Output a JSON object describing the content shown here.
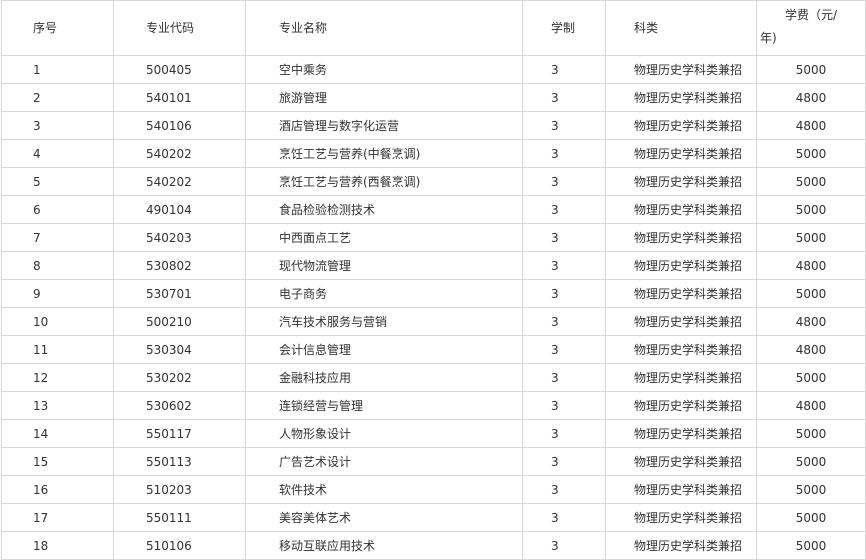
{
  "table": {
    "headers": {
      "no": "序号",
      "code": "专业代码",
      "name": "专业名称",
      "years": "学制",
      "category": "科类",
      "fee_line1": "学费（元/",
      "fee_line2": "年)"
    },
    "rows": [
      {
        "no": "1",
        "code": "500405",
        "name": "空中乘务",
        "years": "3",
        "category": "物理历史学科类兼招",
        "fee": "5000"
      },
      {
        "no": "2",
        "code": "540101",
        "name": "旅游管理",
        "years": "3",
        "category": "物理历史学科类兼招",
        "fee": "4800"
      },
      {
        "no": "3",
        "code": "540106",
        "name": "酒店管理与数字化运营",
        "years": "3",
        "category": "物理历史学科类兼招",
        "fee": "4800"
      },
      {
        "no": "4",
        "code": "540202",
        "name": "烹饪工艺与营养(中餐烹调)",
        "years": "3",
        "category": "物理历史学科类兼招",
        "fee": "5000"
      },
      {
        "no": "5",
        "code": "540202",
        "name": "烹饪工艺与营养(西餐烹调)",
        "years": "3",
        "category": "物理历史学科类兼招",
        "fee": "5000"
      },
      {
        "no": "6",
        "code": "490104",
        "name": "食品检验检测技术",
        "years": "3",
        "category": "物理历史学科类兼招",
        "fee": "5000"
      },
      {
        "no": "7",
        "code": "540203",
        "name": "中西面点工艺",
        "years": "3",
        "category": "物理历史学科类兼招",
        "fee": "5000"
      },
      {
        "no": "8",
        "code": "530802",
        "name": "现代物流管理",
        "years": "3",
        "category": "物理历史学科类兼招",
        "fee": "4800"
      },
      {
        "no": "9",
        "code": "530701",
        "name": "电子商务",
        "years": "3",
        "category": "物理历史学科类兼招",
        "fee": "5000"
      },
      {
        "no": "10",
        "code": "500210",
        "name": "汽车技术服务与营销",
        "years": "3",
        "category": "物理历史学科类兼招",
        "fee": "4800"
      },
      {
        "no": "11",
        "code": "530304",
        "name": "会计信息管理",
        "years": "3",
        "category": "物理历史学科类兼招",
        "fee": "4800"
      },
      {
        "no": "12",
        "code": "530202",
        "name": "金融科技应用",
        "years": "3",
        "category": "物理历史学科类兼招",
        "fee": "5000"
      },
      {
        "no": "13",
        "code": "530602",
        "name": "连锁经营与管理",
        "years": "3",
        "category": "物理历史学科类兼招",
        "fee": "4800"
      },
      {
        "no": "14",
        "code": "550117",
        "name": "人物形象设计",
        "years": "3",
        "category": "物理历史学科类兼招",
        "fee": "5000"
      },
      {
        "no": "15",
        "code": "550113",
        "name": "广告艺术设计",
        "years": "3",
        "category": "物理历史学科类兼招",
        "fee": "5000"
      },
      {
        "no": "16",
        "code": "510203",
        "name": "软件技术",
        "years": "3",
        "category": "物理历史学科类兼招",
        "fee": "5000"
      },
      {
        "no": "17",
        "code": "550111",
        "name": "美容美体艺术",
        "years": "3",
        "category": "物理历史学科类兼招",
        "fee": "5000"
      },
      {
        "no": "18",
        "code": "510106",
        "name": "移动互联应用技术",
        "years": "3",
        "category": "物理历史学科类兼招",
        "fee": "5000"
      }
    ]
  }
}
